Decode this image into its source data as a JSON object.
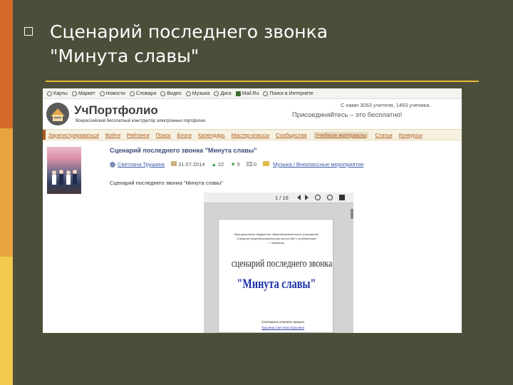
{
  "slide": {
    "title_line1": "Сценарий последнего звонка",
    "title_line2": "\"Минута славы\"",
    "colors": {
      "background": "#4b4f3a",
      "accent_orange": "#d4692b",
      "accent_amber": "#e7a43f",
      "accent_yellow": "#f2c94c",
      "rule": "#e9b93c"
    }
  },
  "toolbar": {
    "items": [
      {
        "label": "Карты",
        "icon": "globe-icon"
      },
      {
        "label": "Маркет",
        "icon": "globe-icon"
      },
      {
        "label": "Новости",
        "icon": "globe-icon"
      },
      {
        "label": "Словари",
        "icon": "globe-icon"
      },
      {
        "label": "Видео",
        "icon": "globe-icon"
      },
      {
        "label": "Музыка",
        "icon": "globe-icon"
      },
      {
        "label": "Диск",
        "icon": "globe-icon"
      },
      {
        "label": "Mail.Ru",
        "icon": "mail-icon"
      },
      {
        "label": "Поиск в Интернете",
        "icon": "search-icon"
      }
    ]
  },
  "site": {
    "logo_text": "УчПортфолио",
    "logo_subtitle": "Всероссийский бесплатный конструктор электронных портфолио",
    "join_stats": "С нами 3063 учителя, 1463 ученика.",
    "join_cta": "Присоединяйтесь – это бесплатно!"
  },
  "nav": {
    "items": [
      {
        "label": "Зарегистрироваться",
        "active": false
      },
      {
        "label": "Войти",
        "active": false
      },
      {
        "label": "Рейтинги",
        "active": false
      },
      {
        "label": "Поиск",
        "active": false
      },
      {
        "label": "Блоги",
        "active": false
      },
      {
        "label": "Календарь",
        "active": false
      },
      {
        "label": "Мастер-классы",
        "active": false
      },
      {
        "label": "Сообщества",
        "active": false
      },
      {
        "label": "Учебные материалы",
        "active": true
      },
      {
        "label": "Статьи",
        "active": false
      },
      {
        "label": "Конкурсы",
        "active": false
      }
    ]
  },
  "article": {
    "title": "Сценарий последнего звонка \"Минута славы\"",
    "author": "Светлана Трушина",
    "date": "31.07.2014",
    "votes_up": "22",
    "votes_down": "5",
    "comments": "0",
    "category": "Музыка / Внеклассные мероприятия",
    "description": "Сценарий последнего звонка \"Минута славы\""
  },
  "viewer": {
    "page_indicator": "1 / 16",
    "doc_header_line1": "Муниципальное бюджетное общеобразовательное учреждение",
    "doc_header_line2": "«Средняя общеобразовательная школа №4 с углублённым»",
    "doc_header_line3": "г. Знаменка",
    "doc_title1": "сценарий последнего звонка",
    "doc_title2": "\"Минута славы\"",
    "doc_footer1": "Составила учитель музыки",
    "doc_footer2": "Трушина Светлана Юрьевна"
  }
}
